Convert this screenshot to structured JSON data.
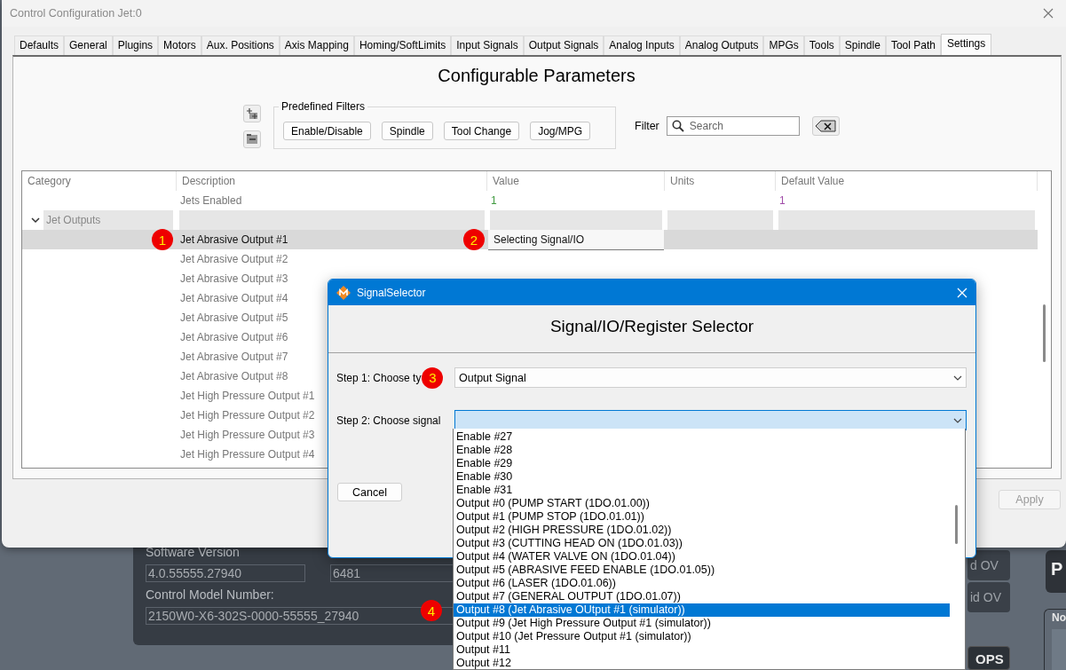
{
  "background_app": {
    "software_version_label": "Software Version",
    "version_fields": [
      "4.0.55555.27940",
      "6481"
    ],
    "model_label": "Control Model Number:",
    "model_number": "2150W0-X6-302S-0000-55555_27940",
    "side_buttons": [
      "d OV",
      "id OV"
    ],
    "ops_button": "OPS",
    "tile_text": "P",
    "group_label": "No"
  },
  "main_window": {
    "title": "Control Configuration Jet:0",
    "tabs": [
      {
        "label": "Defaults",
        "selected": false
      },
      {
        "label": "General",
        "selected": false
      },
      {
        "label": "Plugins",
        "selected": false
      },
      {
        "label": "Motors",
        "selected": false
      },
      {
        "label": "Aux. Positions",
        "selected": false
      },
      {
        "label": "Axis Mapping",
        "selected": false
      },
      {
        "label": "Homing/SoftLimits",
        "selected": false
      },
      {
        "label": "Input Signals",
        "selected": false
      },
      {
        "label": "Output Signals",
        "selected": false
      },
      {
        "label": "Analog Inputs",
        "selected": false
      },
      {
        "label": "Analog Outputs",
        "selected": false
      },
      {
        "label": "MPGs",
        "selected": false
      },
      {
        "label": "Tools",
        "selected": false
      },
      {
        "label": "Spindle",
        "selected": false
      },
      {
        "label": "Tool Path",
        "selected": false
      },
      {
        "label": "Settings",
        "selected": true
      }
    ],
    "heading": "Configurable Parameters",
    "filters": {
      "title": "Predefined Filters",
      "buttons": [
        "Enable/Disable",
        "Spindle",
        "Tool Change",
        "Jog/MPG"
      ]
    },
    "filter_label": "Filter",
    "search": {
      "placeholder": "Search"
    },
    "table": {
      "columns": [
        "Category",
        "Description",
        "Value",
        "Units",
        "Default Value"
      ],
      "rows": [
        {
          "kind": "param",
          "description": "Jets Enabled",
          "value": "1",
          "default_value": "1",
          "selected": false
        },
        {
          "kind": "group",
          "category": "Jet Outputs",
          "expanded": true,
          "selected": false
        },
        {
          "kind": "param",
          "description": "Jet Abrasive Output #1",
          "value": "Selecting Signal/IO",
          "editing": true,
          "selected": true,
          "marker": "1",
          "value_marker": "2"
        },
        {
          "kind": "param",
          "description": "Jet Abrasive Output #2",
          "selected": false
        },
        {
          "kind": "param",
          "description": "Jet Abrasive Output #3",
          "selected": false
        },
        {
          "kind": "param",
          "description": "Jet Abrasive Output #4",
          "selected": false
        },
        {
          "kind": "param",
          "description": "Jet Abrasive Output #5",
          "selected": false
        },
        {
          "kind": "param",
          "description": "Jet Abrasive Output #6",
          "selected": false
        },
        {
          "kind": "param",
          "description": "Jet Abrasive Output #7",
          "selected": false
        },
        {
          "kind": "param",
          "description": "Jet Abrasive Output #8",
          "selected": false
        },
        {
          "kind": "param",
          "description": "Jet High Pressure Output #1",
          "selected": false
        },
        {
          "kind": "param",
          "description": "Jet High Pressure Output #2",
          "selected": false
        },
        {
          "kind": "param",
          "description": "Jet High Pressure Output #3",
          "selected": false
        },
        {
          "kind": "param",
          "description": "Jet High Pressure Output #4",
          "selected": false
        }
      ]
    },
    "footer_buttons": [
      {
        "label": "Apply",
        "disabled": true
      }
    ]
  },
  "signal_dialog": {
    "title": "SignalSelector",
    "heading": "Signal/IO/Register Selector",
    "step1": {
      "label": "Step 1: Choose ty",
      "value": "Output Signal",
      "marker": "3"
    },
    "step2": {
      "label": "Step 2: Choose signal",
      "focused": true,
      "open": true
    },
    "options": [
      {
        "label": "Enable #27",
        "selected": false
      },
      {
        "label": "Enable #28",
        "selected": false
      },
      {
        "label": "Enable #29",
        "selected": false
      },
      {
        "label": "Enable #30",
        "selected": false
      },
      {
        "label": "Enable #31",
        "selected": false
      },
      {
        "label": "Output #0 (PUMP START (1DO.01.00))",
        "selected": false
      },
      {
        "label": "Output #1 (PUMP STOP (1DO.01.01))",
        "selected": false
      },
      {
        "label": "Output #2 (HIGH PRESSURE (1DO.01.02))",
        "selected": false
      },
      {
        "label": "Output #3 (CUTTING HEAD ON (1DO.01.03))",
        "selected": false
      },
      {
        "label": "Output #4 (WATER VALVE ON (1DO.01.04))",
        "selected": false
      },
      {
        "label": "Output #5 (ABRASIVE FEED ENABLE (1DO.01.05))",
        "selected": false
      },
      {
        "label": "Output #6 (LASER (1DO.01.06))",
        "selected": false
      },
      {
        "label": "Output #7 (GENERAL OUTPUT (1DO.01.07))",
        "selected": false
      },
      {
        "label": "Output #8 (Jet Abrasive OUtput #1 (simulator))",
        "selected": true,
        "marker": "4"
      },
      {
        "label": "Output #9 (Jet High Pressure Output #1 (simulator))",
        "selected": false
      },
      {
        "label": "Output #10 (Jet Pressure Output #1 (simulator))",
        "selected": false
      },
      {
        "label": "Output #11",
        "selected": false
      },
      {
        "label": "Output #12",
        "selected": false
      }
    ],
    "cancel_button": "Cancel"
  }
}
